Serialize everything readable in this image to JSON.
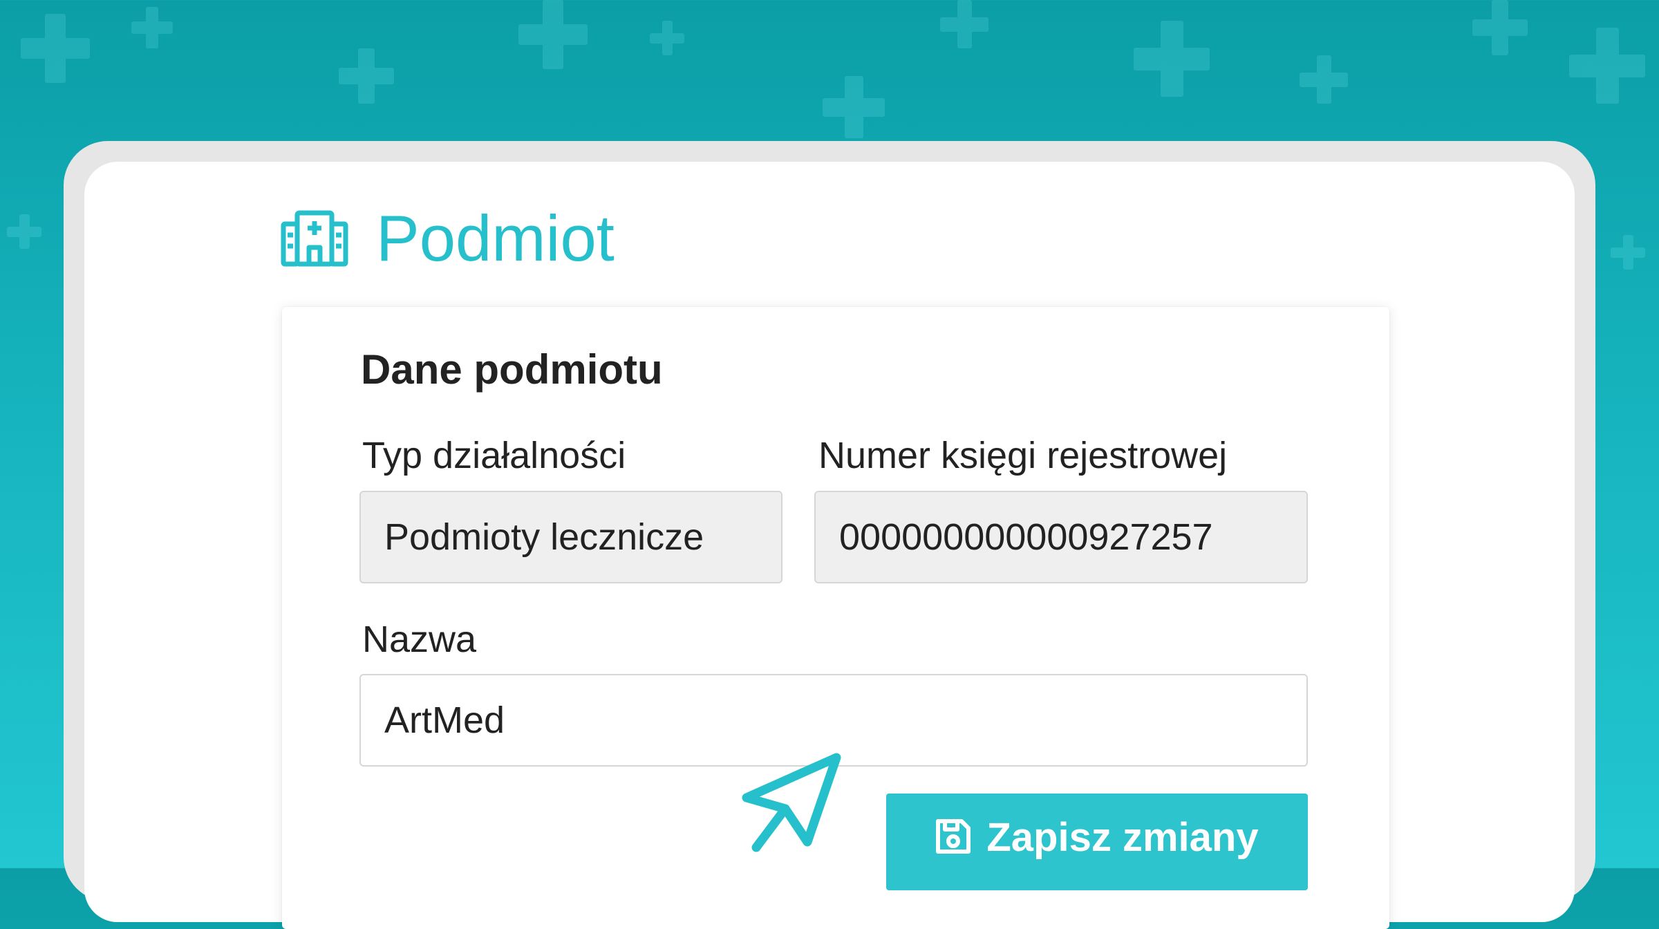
{
  "page": {
    "title": "Podmiot",
    "title_icon": "hospital-icon"
  },
  "form": {
    "section_title": "Dane podmiotu",
    "fields": {
      "business_type": {
        "label": "Typ działalności",
        "value": "Podmioty lecznicze"
      },
      "registry_number": {
        "label": "Numer księgi rejestrowej",
        "value": "000000000000927257"
      },
      "name": {
        "label": "Nazwa",
        "value": "ArtMed"
      }
    },
    "save_button": {
      "label": "Zapisz zmiany",
      "icon": "floppy-disk-icon"
    }
  },
  "cursor_icon": "pointer-arrow-icon",
  "colors": {
    "accent": "#2ec4ce",
    "title": "#25c0cb",
    "background_top": "#0b9ea6",
    "background_bottom": "#22c7d1",
    "readonly_field": "#efefef"
  }
}
